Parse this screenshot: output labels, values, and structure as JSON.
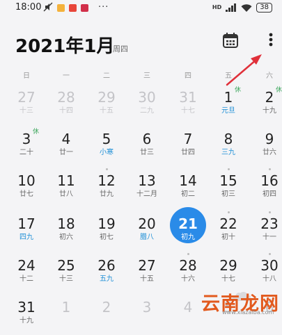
{
  "status": {
    "time": "18:00",
    "dots": "···",
    "network": "HD",
    "battery": "38"
  },
  "header": {
    "title": "2021年1月",
    "weekday": "周四"
  },
  "weekdays": [
    "日",
    "一",
    "二",
    "三",
    "四",
    "五",
    "六"
  ],
  "weeks": [
    [
      {
        "d": "27",
        "l": "十三",
        "other": true
      },
      {
        "d": "28",
        "l": "十四",
        "other": true
      },
      {
        "d": "29",
        "l": "十五",
        "other": true
      },
      {
        "d": "30",
        "l": "二九",
        "other": true
      },
      {
        "d": "31",
        "l": "十七",
        "other": true
      },
      {
        "d": "1",
        "l": "元旦",
        "blue": true,
        "badge": "休"
      },
      {
        "d": "2",
        "l": "十九",
        "badge": "休"
      }
    ],
    [
      {
        "d": "3",
        "l": "二十",
        "badge": "休"
      },
      {
        "d": "4",
        "l": "廿一"
      },
      {
        "d": "5",
        "l": "小寒",
        "blue": true
      },
      {
        "d": "6",
        "l": "廿三"
      },
      {
        "d": "7",
        "l": "廿四"
      },
      {
        "d": "8",
        "l": "三九",
        "blue": true
      },
      {
        "d": "9",
        "l": "廿六"
      }
    ],
    [
      {
        "d": "10",
        "l": "廿七"
      },
      {
        "d": "11",
        "l": "廿八"
      },
      {
        "d": "12",
        "l": "廿九",
        "dot": true
      },
      {
        "d": "13",
        "l": "十二月"
      },
      {
        "d": "14",
        "l": "初二"
      },
      {
        "d": "15",
        "l": "初三",
        "dot": true
      },
      {
        "d": "16",
        "l": "初四",
        "dot": true
      }
    ],
    [
      {
        "d": "17",
        "l": "四九",
        "blue": true
      },
      {
        "d": "18",
        "l": "初六"
      },
      {
        "d": "19",
        "l": "初七"
      },
      {
        "d": "20",
        "l": "腊八",
        "blue": true
      },
      {
        "d": "21",
        "l": "初九",
        "today": true
      },
      {
        "d": "22",
        "l": "初十",
        "dot": true
      },
      {
        "d": "23",
        "l": "十一",
        "dot": true
      }
    ],
    [
      {
        "d": "24",
        "l": "十二"
      },
      {
        "d": "25",
        "l": "十三"
      },
      {
        "d": "26",
        "l": "五九",
        "blue": true
      },
      {
        "d": "27",
        "l": "十五"
      },
      {
        "d": "28",
        "l": "十六",
        "dot": true
      },
      {
        "d": "29",
        "l": "十七"
      },
      {
        "d": "30",
        "l": "十八",
        "dot": true
      }
    ],
    [
      {
        "d": "31",
        "l": "十九"
      },
      {
        "d": "1",
        "l": "",
        "other": true
      },
      {
        "d": "2",
        "l": "",
        "other": true
      },
      {
        "d": "3",
        "l": "",
        "other": true
      },
      {
        "d": "4",
        "l": "",
        "other": true
      },
      {
        "d": "5",
        "l": "",
        "other": true
      },
      {
        "d": "6",
        "l": "",
        "other": true
      }
    ]
  ],
  "watermark": {
    "text": "云南龙网",
    "url": "www.xiazaiba.com"
  },
  "colors": {
    "accent": "#2a8be8",
    "festival": "#1e8fd6",
    "holiday": "#3aa65a",
    "annotation": "#e0303a"
  }
}
